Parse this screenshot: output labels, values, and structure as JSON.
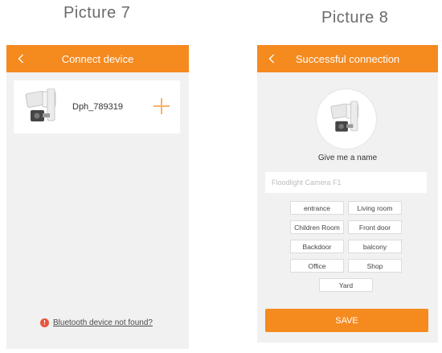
{
  "captions": {
    "left": "Picture 7",
    "right": "Picture 8"
  },
  "screen_connect": {
    "title": "Connect device",
    "back_icon": "chevron-left-icon",
    "device": {
      "name": "Dph_789319",
      "icon": "floodlight-camera-icon",
      "action_icon": "plus-icon"
    },
    "help_text": "Bluetooth device not found?",
    "help_icon": "exclamation-icon",
    "accent": "#f58a1f"
  },
  "screen_success": {
    "title": "Successful connection",
    "back_icon": "chevron-left-icon",
    "prompt": "Give me a name",
    "input_placeholder": "Floodlight Camera F1",
    "input_value": "",
    "chips": [
      "entrance",
      "Living room",
      "Children Room",
      "Front door",
      "Backdoor",
      "balcony",
      "Office",
      "Shop",
      "Yard"
    ],
    "save_label": "SAVE",
    "accent": "#f58a1f"
  }
}
